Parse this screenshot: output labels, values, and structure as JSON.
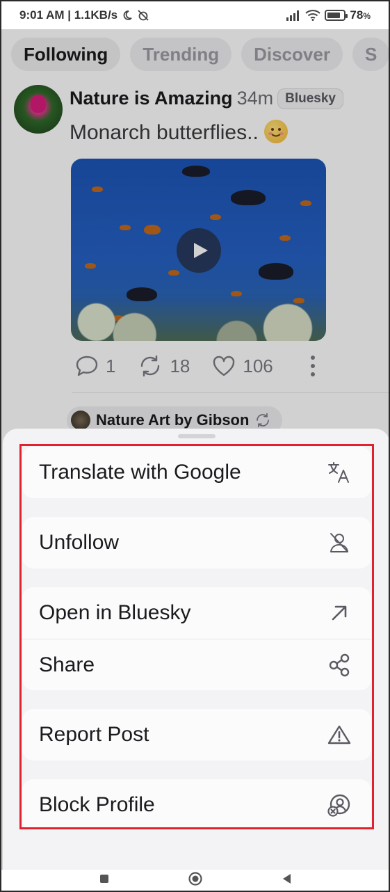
{
  "status_bar": {
    "time": "9:01 AM | 1.1KB/s",
    "battery": "78",
    "battery_suffix": "%",
    "battery_level": 0.78
  },
  "feed_tabs": [
    {
      "label": "Following",
      "active": true
    },
    {
      "label": "Trending",
      "active": false
    },
    {
      "label": "Discover",
      "active": false
    },
    {
      "label": "S",
      "active": false
    }
  ],
  "post": {
    "author": "Nature is Amazing",
    "time": "34m",
    "source_badge": "Bluesky",
    "text": "Monarch butterflies..",
    "emoji": "smiling-face",
    "replies": "1",
    "reposts": "18",
    "likes": "106"
  },
  "next_post": {
    "repost_author": "Nature Art by Gibson"
  },
  "sheet": {
    "groups": [
      {
        "items": [
          {
            "label": "Translate with Google",
            "icon": "translate-icon"
          }
        ]
      },
      {
        "items": [
          {
            "label": "Unfollow",
            "icon": "unfollow-icon"
          }
        ]
      },
      {
        "items": [
          {
            "label": "Open in Bluesky",
            "icon": "open-external-icon"
          },
          {
            "label": "Share",
            "icon": "share-icon"
          }
        ]
      },
      {
        "items": [
          {
            "label": "Report Post",
            "icon": "warning-icon"
          }
        ]
      },
      {
        "items": [
          {
            "label": "Block Profile",
            "icon": "block-profile-icon"
          }
        ]
      }
    ],
    "highlight_color": "#e0212e"
  },
  "nav_bar": {
    "buttons": [
      "recents-button",
      "home-button",
      "back-button"
    ]
  }
}
